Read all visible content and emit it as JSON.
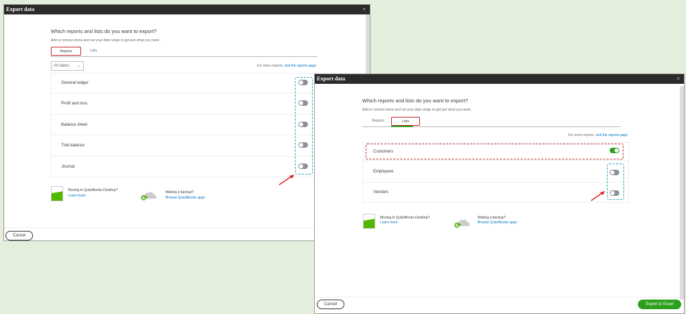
{
  "left_dialog": {
    "title": "Export data",
    "close": "×",
    "heading": "Which reports and lists do you want to export?",
    "subtext": "Add or remove items and set your date range to get just what you need.",
    "tabs": [
      {
        "label": "Reports",
        "active": true
      },
      {
        "label": "Lists",
        "active": false
      }
    ],
    "date_filter": "All dates",
    "more_prefix": "For more reports,",
    "more_link": "visit the reports page",
    "rows": [
      {
        "label": "General ledger",
        "on": false
      },
      {
        "label": "Profit and loss",
        "on": false
      },
      {
        "label": "Balance sheet",
        "on": false
      },
      {
        "label": "Trial balance",
        "on": false
      },
      {
        "label": "Journal",
        "on": false
      }
    ],
    "promo1_title": "Moving to QuickBooks Desktop?",
    "promo1_link": "Learn more",
    "promo2_title": "Making a backup?",
    "promo2_link": "Browse QuickBooks apps",
    "cancel": "Cancel"
  },
  "right_dialog": {
    "title": "Export data",
    "close": "×",
    "heading": "Which reports and lists do you want to export?",
    "subtext": "Add or remove items and set your date range to get just what you need.",
    "tabs": [
      {
        "label": "Reports",
        "active": false
      },
      {
        "label": "Lists",
        "active": true
      }
    ],
    "more_prefix": "For more reports,",
    "more_link": "visit the reports page",
    "rows": [
      {
        "label": "Customers",
        "on": true
      },
      {
        "label": "Employees",
        "on": false
      },
      {
        "label": "Vendors",
        "on": false
      }
    ],
    "promo1_title": "Moving to QuickBooks Desktop?",
    "promo1_link": "Learn more",
    "promo2_title": "Making a backup?",
    "promo2_link": "Browse QuickBooks apps",
    "cancel": "Cancel",
    "export": "Export to Excel"
  },
  "colors": {
    "accent": "#2ca01c",
    "highlight": "#c0282b",
    "annotation": "#2aa8b8"
  }
}
